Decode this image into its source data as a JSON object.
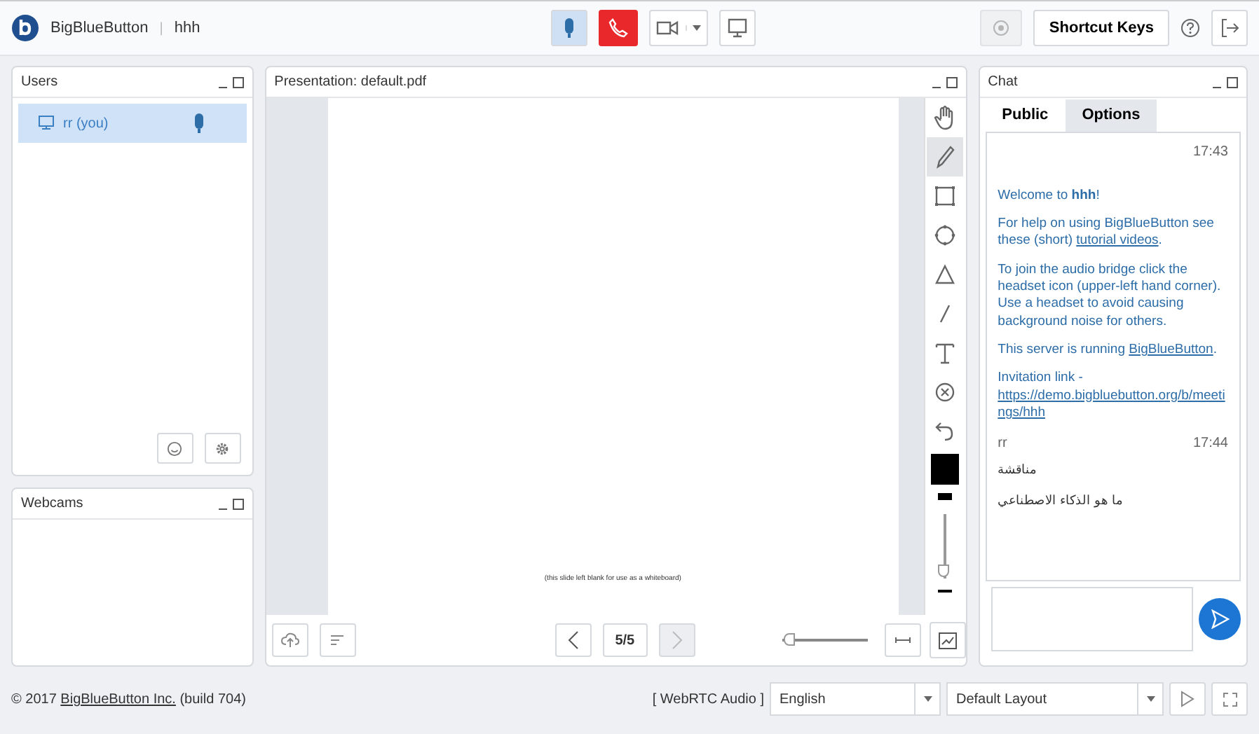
{
  "topbar": {
    "brand": "BigBlueButton",
    "separator": "|",
    "meeting": "hhh",
    "controls": [
      {
        "kind": "mic",
        "active": true
      },
      {
        "kind": "hangup",
        "active": true
      },
      {
        "kind": "camera",
        "active": false
      },
      {
        "kind": "screen",
        "active": false
      }
    ],
    "record": {
      "disabled": true
    },
    "shortcut_keys": "Shortcut Keys"
  },
  "users": {
    "title": "Users",
    "items": [
      {
        "name": "rr (you)",
        "selected": true
      }
    ]
  },
  "webcams": {
    "title": "Webcams"
  },
  "presentation": {
    "title": "Presentation: default.pdf",
    "slide_note": "(this slide left blank for use as a whiteboard)",
    "page": "5/5",
    "zoom": {
      "level": 0.02
    },
    "tools": [
      {
        "kind": "hand",
        "selected": false
      },
      {
        "kind": "pencil",
        "selected": true
      },
      {
        "kind": "rectangle",
        "selected": false
      },
      {
        "kind": "ellipse",
        "selected": false
      },
      {
        "kind": "triangle",
        "selected": false
      },
      {
        "kind": "line",
        "selected": false
      },
      {
        "kind": "text",
        "selected": false
      },
      {
        "kind": "clear",
        "selected": false
      },
      {
        "kind": "undo",
        "selected": false
      }
    ],
    "color": "#000000",
    "thickness": {
      "level": 0.0
    }
  },
  "chat": {
    "title": "Chat",
    "tabs": [
      {
        "label": "Public",
        "selected": true
      },
      {
        "label": "Options",
        "selected": false
      }
    ],
    "groups": [
      {
        "time": "17:43",
        "messages": [
          [
            {
              "kind": "rich",
              "text": "Welcome to **hhh**!"
            }
          ],
          [
            {
              "kind": "text",
              "text": "For help on using BigBlueButton see these (short) "
            },
            {
              "kind": "link",
              "text": "tutorial videos"
            },
            {
              "kind": "text",
              "text": "."
            }
          ],
          [
            {
              "kind": "text",
              "text": "To join the audio bridge click the headset icon (upper-left hand corner).  Use a headset to avoid causing background noise for others."
            }
          ],
          [
            {
              "kind": "text",
              "text": "This server is running "
            },
            {
              "kind": "link",
              "text": "BigBlueButton"
            },
            {
              "kind": "text",
              "text": "."
            }
          ],
          [
            {
              "kind": "text",
              "text": "Invitation link - "
            },
            {
              "kind": "url",
              "text": "https://demo.bigbluebutton.org/b/meetings/hhh"
            }
          ]
        ]
      },
      {
        "sender": "rr",
        "time": "17:44",
        "messages": [
          [
            {
              "kind": "arabic",
              "text": "مناقشة"
            }
          ],
          [
            {
              "kind": "arabic",
              "text": "ما هو الذكاء الاصطناعي"
            }
          ]
        ]
      }
    ]
  },
  "footer": {
    "copyright": "© 2017 ",
    "company": "BigBlueButton Inc.",
    "build": " (build 704)",
    "audio": "[ WebRTC Audio ]",
    "language": "English",
    "layout": "Default Layout"
  }
}
